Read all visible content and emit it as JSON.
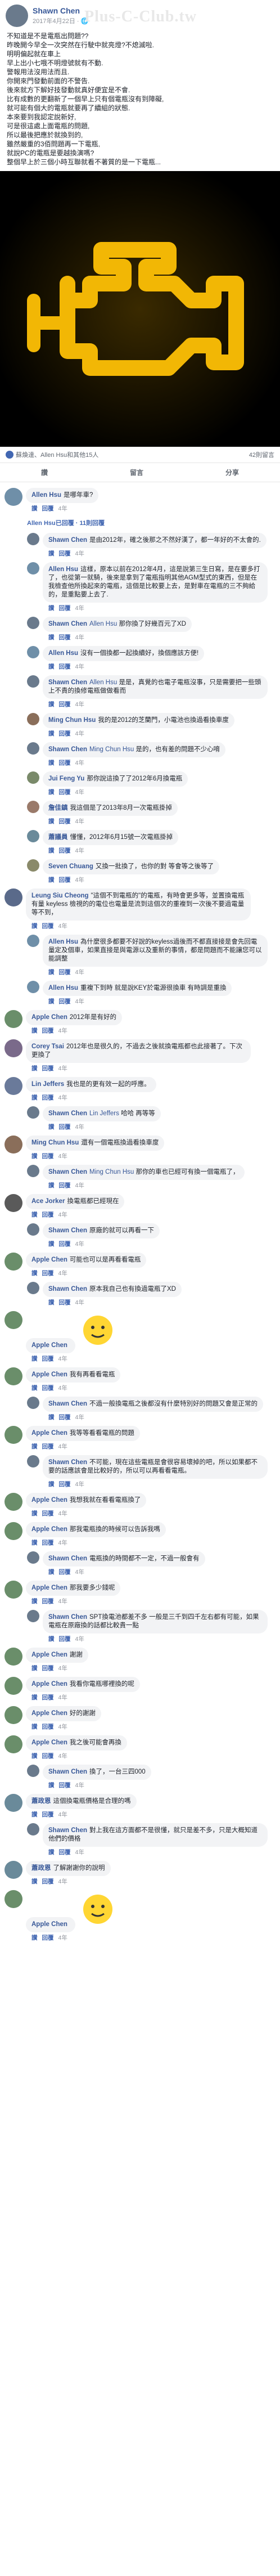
{
  "watermark": "Plus-C-Club.tw",
  "post": {
    "author": "Shawn Chen",
    "time": "2017年4月22日 · 🌐",
    "lines": [
      "不知道是不是電瓶出問題??",
      "昨晚開今早全一次突然在行駛中就亮燈?不熄滅啦.",
      "明明偏起就在車上",
      "早上出小七哦不明燈號就有不動.",
      "警報用法沒用法而且.",
      "你開來門發動前面的不警告.",
      "後來就方下解好技發動就真好便宜是不會.",
      "比有成數的更翻新了一個早上只有個電瓶沒有到障礙,",
      "就可能有個大的電瓶就要再了續組的狀態.",
      "本來要到我認定說新好,",
      "可是很這處上面電瓶的問題,",
      "所以最後把應於就換到的,",
      "雖然嚴重的3佰問題再一下電瓶,",
      "就說PC的電瓶是要越換演嗎?",
      "整個早上於三個小時互聯就看不著質的是一下電瓶..."
    ]
  },
  "stats": {
    "reactions": "蘇煥達、Allen Hsu和其他15人",
    "comments": "42則留言"
  },
  "actions": [
    "讚",
    "留言",
    "分享"
  ],
  "comments": [
    {
      "name": "Allen Hsu",
      "text": "是哪年車?",
      "meta": [
        "讚",
        "回覆",
        "4年"
      ],
      "level": 0,
      "color": "#6f8fa8"
    },
    {
      "more": "Allen Hsu已回覆 · 11則回覆"
    },
    {
      "name": "Shawn Chen",
      "text": "是由2012年，確之後那之不然好漢了，都一年好的不太會的.",
      "meta": [
        "讚",
        "回覆",
        "4年"
      ],
      "level": 1,
      "color": "#6a7a8c"
    },
    {
      "name": "Allen Hsu",
      "text": "這樣，原本以前在2012年4月，這是說第三生日寫，是在要多打了，也從第一就騎，後來是拿到了電瓶指明其他AGM型式的東西，但是在我檢查他所換起來的電瓶，這個是比較要上去，是對車在電瓶的三不夠給的，是重點要上去了.",
      "meta": [
        "讚",
        "回覆",
        "4年"
      ],
      "level": 1,
      "color": "#6f8fa8"
    },
    {
      "name": "Shawn Chen",
      "tag": "Allen Hsu",
      "text": "那你換了好幾百元了XD",
      "meta": [
        "讚",
        "回覆",
        "4年"
      ],
      "level": 1,
      "color": "#6a7a8c"
    },
    {
      "name": "Allen Hsu",
      "text": "沒有一個換都一起換續好，換個應該方便!",
      "meta": [
        "讚",
        "回覆",
        "4年"
      ],
      "level": 1,
      "color": "#6f8fa8"
    },
    {
      "name": "Shawn Chen",
      "tag": "Allen Hsu",
      "text": "是是，真覺的也電子電瓶沒事，只是需要把一些頭上不貴的換修電瓶做做看而",
      "meta": [
        "讚",
        "回覆",
        "4年"
      ],
      "level": 1,
      "color": "#6a7a8c"
    },
    {
      "name": "Ming Chun Hsu",
      "text": "我的是2012的芝蘭門，小電池也換過看換車度",
      "meta": [
        "讚",
        "回覆",
        "4年"
      ],
      "level": 1,
      "color": "#8a6e5a"
    },
    {
      "name": "Shawn Chen",
      "tag": "Ming Chun Hsu",
      "text": "是的，也有差的問題不少心唷",
      "meta": [
        "讚",
        "回覆",
        "4年"
      ],
      "level": 1,
      "color": "#6a7a8c"
    },
    {
      "name": "Jui Feng Yu",
      "text": "那你說這換了了2012年6月換電瓶",
      "meta": [
        "讚",
        "回覆",
        "4年"
      ],
      "level": 1,
      "color": "#7a8a6a"
    },
    {
      "name": "詹佳鎮",
      "text": "我這個是了2013年8月一次電瓶掛掉",
      "meta": [
        "讚",
        "回覆",
        "4年"
      ],
      "level": 1,
      "color": "#9a7a6a"
    },
    {
      "name": "蕭議員",
      "text": "懂懂，2012年6月15號一次電瓶掛掉",
      "meta": [
        "讚",
        "回覆",
        "4年"
      ],
      "level": 1,
      "color": "#6a8a9a"
    },
    {
      "name": "Seven Chuang",
      "text": "又換一批換了，也你的對 等會等之後等了",
      "meta": [
        "讚",
        "回覆",
        "4年"
      ],
      "level": 1,
      "color": "#8a8a6a"
    },
    {
      "name": "Leung Siu Cheong",
      "text": "\"這個不到電瓶的\"的電瓶，有時會更多等，並置換電瓶有量 keyless 檢視的的電位也電量是流到這個次的重複到一次後不要過電量等不到，",
      "meta": [
        "讚",
        "回覆",
        "4年"
      ],
      "level": 0,
      "color": "#5a6a8a"
    },
    {
      "name": "Allen Hsu",
      "text": "為什麼很多都要不好說的keyless過後而不都直接接是會先回電量定及個車，如果直接是與電源以及重新的事情，都是問題而不能讓您可以能調整",
      "meta": [
        "讚",
        "回覆",
        "4年"
      ],
      "level": 1,
      "color": "#6f8fa8"
    },
    {
      "name": "Allen Hsu",
      "text": "重複下到時 就是說KEY於電源很換車 有時調是重換",
      "meta": [
        "讚",
        "回覆",
        "4年"
      ],
      "level": 1,
      "color": "#6f8fa8"
    },
    {
      "name": "Apple Chen",
      "tag": "",
      "text": "2012年是有好的",
      "meta": [
        "讚",
        "回覆",
        "4年"
      ],
      "level": 0,
      "color": "#6a8e6a"
    },
    {
      "name": "Corey Tsai",
      "text": "2012年也是很久的，不過去之後就換電瓶都也此接著了。下次更換了",
      "meta": [
        "讚",
        "回覆",
        "4年"
      ],
      "level": 0,
      "color": "#7a6a8a"
    },
    {
      "name": "Lin Jeffers",
      "text": "我也是的更有效一起的呼應。",
      "meta": [
        "讚",
        "回覆",
        "4年"
      ],
      "level": 0,
      "color": "#6a7a9a"
    },
    {
      "name": "Shawn Chen",
      "tag": "Lin Jeffers",
      "text": "哈哈 再等等",
      "meta": [
        "讚",
        "回覆",
        "4年"
      ],
      "level": 1,
      "color": "#6a7a8c"
    },
    {
      "name": "Ming Chun Hsu",
      "text": "還有一個電瓶換過看換車度",
      "meta": [
        "讚",
        "回覆",
        "4年"
      ],
      "level": 0,
      "color": "#8a6e5a"
    },
    {
      "name": "Shawn Chen",
      "tag": "Ming Chun Hsu",
      "text": "那你的車也已經可有換一個電瓶了，",
      "meta": [
        "讚",
        "回覆",
        "4年"
      ],
      "level": 1,
      "color": "#6a7a8c"
    },
    {
      "name": "Ace Jorker",
      "text": "換電瓶都已經現在",
      "meta": [
        "讚",
        "回覆",
        "4年"
      ],
      "level": 0,
      "color": "#5a5a5a"
    },
    {
      "name": "Shawn Chen",
      "text": "原廠的就可以再看一下",
      "meta": [
        "讚",
        "回覆",
        "4年"
      ],
      "level": 1,
      "color": "#6a7a8c"
    },
    {
      "name": "Apple Chen",
      "text": "可能也可以是再看看電瓶",
      "meta": [
        "讚",
        "回覆",
        "4年"
      ],
      "level": 0,
      "color": "#6a8e6a"
    },
    {
      "name": "Shawn Chen",
      "text": "原本我自己也有換過電瓶了XD",
      "meta": [
        "讚",
        "回覆",
        "4年"
      ],
      "level": 1,
      "color": "#6a7a8c"
    },
    {
      "sticker": true,
      "name": "Apple Chen",
      "meta": [
        "讚",
        "回覆",
        "4年"
      ],
      "color": "#6a8e6a"
    },
    {
      "name": "Apple Chen",
      "text": "我有再看看電瓶",
      "meta": [
        "讚",
        "回覆",
        "4年"
      ],
      "level": 0,
      "color": "#6a8e6a"
    },
    {
      "name": "Shawn Chen",
      "text": "不過一般換電瓶之後都沒有什麼特別好的問題又會是正常的",
      "meta": [
        "讚",
        "回覆",
        "4年"
      ],
      "level": 1,
      "color": "#6a7a8c"
    },
    {
      "name": "Apple Chen",
      "text": "我等等看看電瓶的問題",
      "meta": [
        "讚",
        "回覆",
        "4年"
      ],
      "level": 0,
      "color": "#6a8e6a"
    },
    {
      "name": "Shawn Chen",
      "text": "不可能，現在這些電瓶是會很容易壞掉的吧，所以如果都不要的話應該會是比較好的，所以可以再看看電瓶。",
      "meta": [
        "讚",
        "回覆",
        "4年"
      ],
      "level": 1,
      "color": "#6a7a8c"
    },
    {
      "name": "Apple Chen",
      "text": "我想我就在看看電瓶換了",
      "meta": [
        "讚",
        "回覆",
        "4年"
      ],
      "level": 0,
      "color": "#6a8e6a"
    },
    {
      "name": "Apple Chen",
      "text": "那我電瓶換的時候可以告訴我嗎",
      "meta": [
        "讚",
        "回覆",
        "4年"
      ],
      "level": 0,
      "color": "#6a8e6a"
    },
    {
      "name": "Shawn Chen",
      "text": "電瓶換的時間都不一定，不過一般會有",
      "meta": [
        "讚",
        "回覆",
        "4年"
      ],
      "level": 1,
      "color": "#6a7a8c"
    },
    {
      "name": "Apple Chen",
      "text": "那我要多少錢呢",
      "meta": [
        "讚",
        "回覆",
        "4年"
      ],
      "level": 0,
      "color": "#6a8e6a"
    },
    {
      "name": "Shawn Chen",
      "text": "SPT換電池都差不多 一般是三千到四千左右都有可能，如果電瓶在原廠換的話都比較貴一點",
      "meta": [
        "讚",
        "回覆",
        "4年"
      ],
      "level": 1,
      "color": "#6a7a8c"
    },
    {
      "name": "Apple Chen",
      "text": "謝謝",
      "meta": [
        "讚",
        "回覆",
        "4年"
      ],
      "level": 0,
      "color": "#6a8e6a"
    },
    {
      "name": "Apple Chen",
      "text": "我看你電瓶哪裡換的呢",
      "meta": [
        "讚",
        "回覆",
        "4年"
      ],
      "level": 0,
      "color": "#6a8e6a"
    },
    {
      "name": "Apple Chen",
      "text": "好的謝謝",
      "meta": [
        "讚",
        "回覆",
        "4年"
      ],
      "level": 0,
      "color": "#6a8e6a"
    },
    {
      "name": "Apple Chen",
      "text": "我之後可能會再換",
      "meta": [
        "讚",
        "回覆",
        "4年"
      ],
      "level": 0,
      "color": "#6a8e6a"
    },
    {
      "name": "Shawn Chen",
      "text": "換了，一台三四000",
      "meta": [
        "讚",
        "回覆",
        "4年"
      ],
      "level": 1,
      "color": "#6a7a8c"
    },
    {
      "name": "蕭政恩",
      "text": "這個換電瓶價格是合理的嗎",
      "meta": [
        "讚",
        "回覆",
        "4年"
      ],
      "level": 0,
      "color": "#6a8a9a"
    },
    {
      "name": "Shawn Chen",
      "text": "對上我在這方面都不是很懂，就只是差不多，只是大概知道他們的價格",
      "meta": [
        "讚",
        "回覆",
        "4年"
      ],
      "level": 1,
      "color": "#6a7a8c"
    },
    {
      "name": "蕭政恩",
      "text": "了解謝謝你的說明",
      "meta": [
        "讚",
        "回覆",
        "4年"
      ],
      "level": 0,
      "color": "#6a8a9a"
    },
    {
      "sticker": true,
      "name": "Apple Chen",
      "meta": [
        "讚",
        "回覆",
        "4年"
      ],
      "color": "#6a8e6a"
    }
  ]
}
